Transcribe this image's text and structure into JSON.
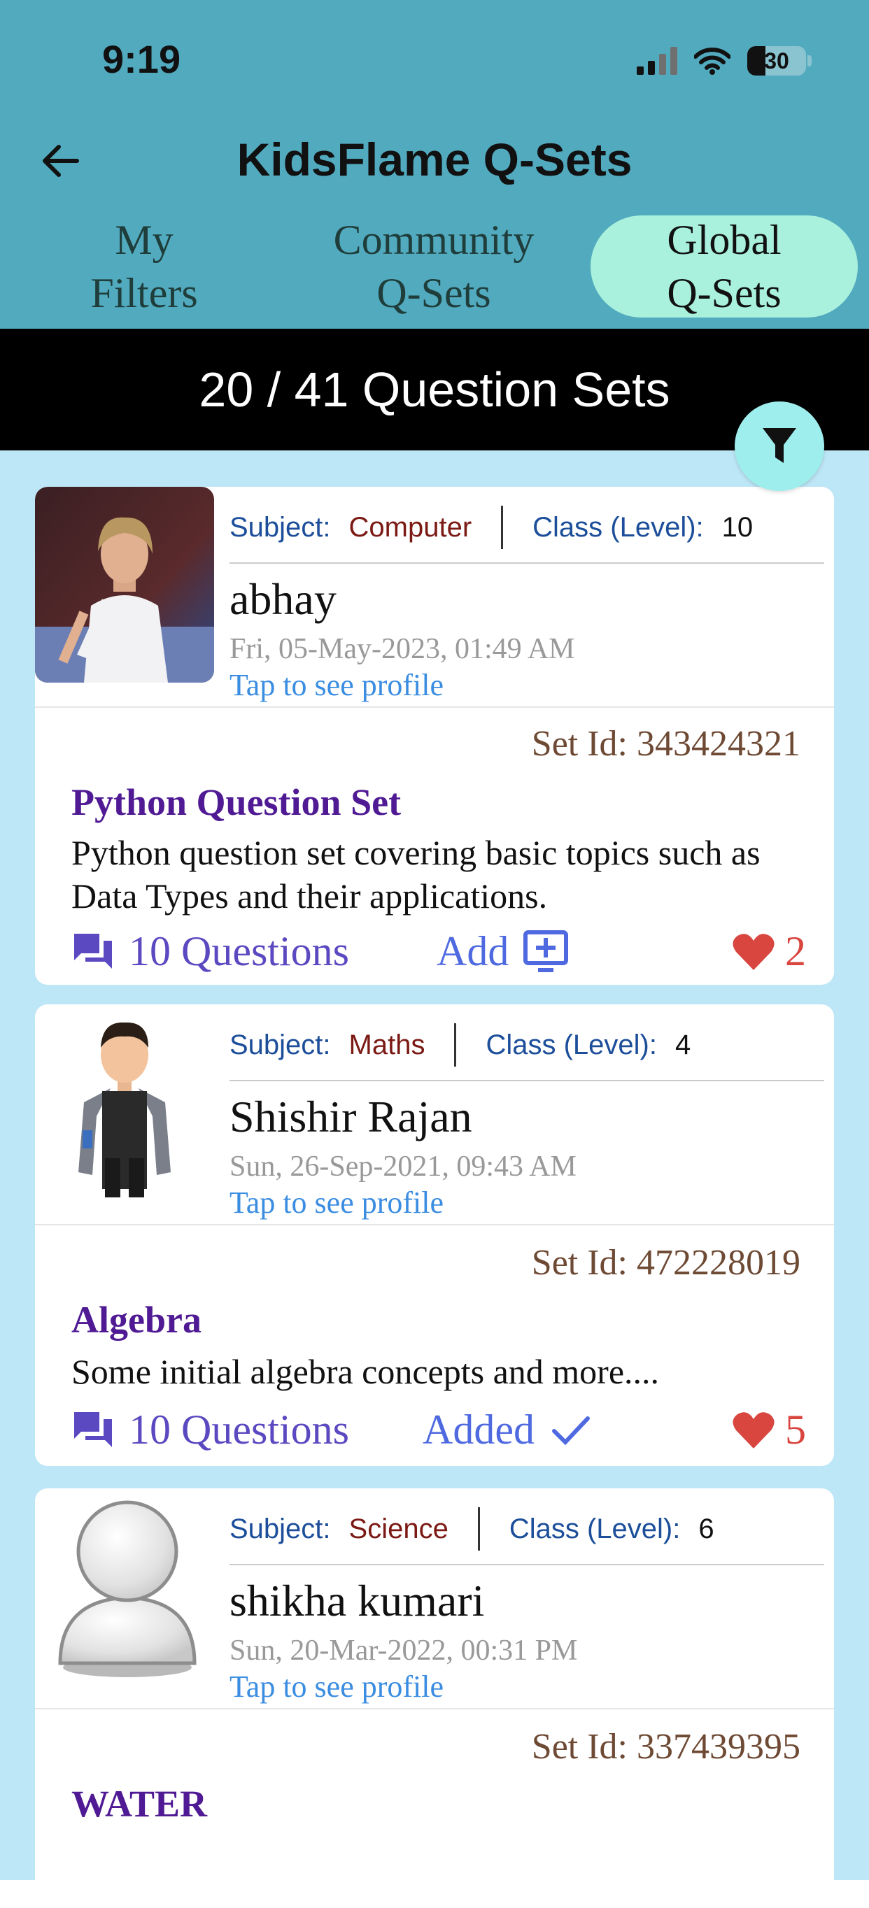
{
  "status": {
    "time": "9:19",
    "battery": "30"
  },
  "header": {
    "title": "KidsFlame Q-Sets",
    "tabs": [
      {
        "label": "My\nFilters",
        "active": false
      },
      {
        "label": "Community\nQ-Sets",
        "active": false
      },
      {
        "label": "Global\nQ-Sets",
        "active": true
      }
    ]
  },
  "count_label": "20 / 41 Question Sets",
  "labels": {
    "subject": "Subject:",
    "class_level": "Class (Level):",
    "tap_profile": "Tap to see profile",
    "questions_suffix": "Questions"
  },
  "cards": [
    {
      "subject": "Computer",
      "class_level": "10",
      "author": "abhay",
      "date": "Fri, 05-May-2023, 01:49 AM",
      "set_id": "Set Id: 343424321",
      "title": "Python Question Set",
      "description": "Python question set covering basic topics such as Data Types and their applications.",
      "questions": "10 Questions",
      "add_label": "Add",
      "likes": "2"
    },
    {
      "subject": "Maths",
      "class_level": "4",
      "author": "Shishir Rajan",
      "date": "Sun, 26-Sep-2021, 09:43 AM",
      "set_id": "Set Id: 472228019",
      "title": "Algebra",
      "description": "Some initial algebra concepts and more....",
      "questions": "10 Questions",
      "add_label": "Added",
      "likes": "5"
    },
    {
      "subject": "Science",
      "class_level": "6",
      "author": "shikha kumari",
      "date": "Sun, 20-Mar-2022, 00:31 PM",
      "set_id": "Set Id: 337439395",
      "title": "WATER",
      "description": "",
      "questions": "",
      "add_label": "",
      "likes": ""
    }
  ],
  "colors": {
    "header": "#52aabf",
    "active_tab": "#a9f1dc",
    "background": "#bde6f6",
    "subject": "#7b1a14",
    "title": "#4f1a93",
    "like": "#d9453f"
  }
}
